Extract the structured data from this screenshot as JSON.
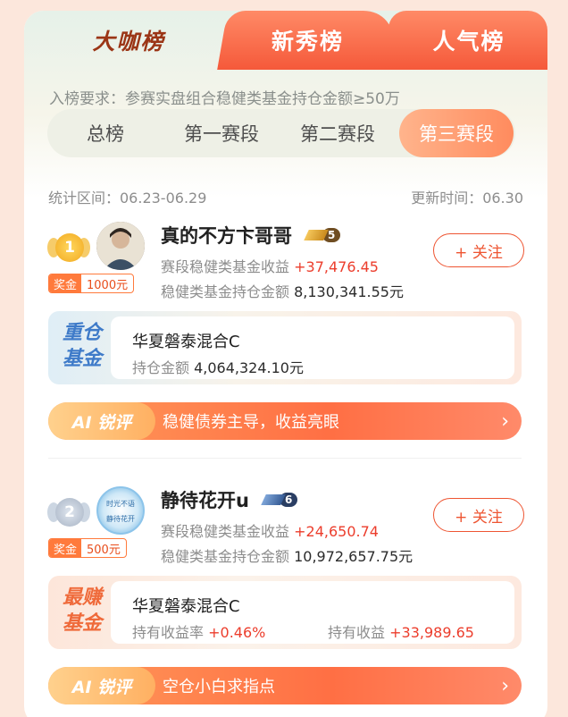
{
  "tabs": {
    "main": "大咖榜",
    "second": "新秀榜",
    "third": "人气榜"
  },
  "requirement": "入榜要求：参赛实盘组合稳健类基金持仓金额≥50万",
  "segments": [
    "总榜",
    "第一赛段",
    "第二赛段",
    "第三赛段"
  ],
  "active_segment": "第三赛段",
  "stats": {
    "period": "统计区间：06.23-06.29",
    "updated": "更新时间：06.30"
  },
  "entries": [
    {
      "rank": "1",
      "prize_label": "奖金",
      "prize_amount": "1000元",
      "name": "真的不方卞哥哥",
      "level": "5",
      "follow": "+ 关注",
      "income_label": "赛段稳健类基金收益",
      "income_value": "+37,476.45",
      "holding_label": "稳健类基金持仓金额",
      "holding_value": "8,130,341.55元",
      "fund_tag_1": "重仓",
      "fund_tag_2": "基金",
      "fund_name": "华夏磐泰混合C",
      "fund_sub_label": "持仓金额",
      "fund_sub_value": "4,064,324.10元",
      "ai_label": "AI 锐评",
      "ai_text": "稳健债券主导，收益亮眼"
    },
    {
      "rank": "2",
      "prize_label": "奖金",
      "prize_amount": "500元",
      "name": "静待花开u",
      "level": "6",
      "avatar_text_top": "时光不语",
      "avatar_text_bottom": "静待花开",
      "follow": "+ 关注",
      "income_label": "赛段稳健类基金收益",
      "income_value": "+24,650.74",
      "holding_label": "稳健类基金持仓金额",
      "holding_value": "10,972,657.75元",
      "fund_tag_1": "最赚",
      "fund_tag_2": "基金",
      "fund_name": "华夏磐泰混合C",
      "fund_rate_label": "持有收益率",
      "fund_rate_value": "+0.46%",
      "fund_income_label": "持有收益",
      "fund_income_value": "+33,989.65",
      "ai_label": "AI 锐评",
      "ai_text": "空仓小白求指点"
    }
  ],
  "colors": {
    "accent": "#ff6f44",
    "red": "#ec3d2c",
    "gold": "#f2a91f",
    "silver": "#a7b3c4"
  },
  "icons": {
    "chevron": "chevron-right-icon",
    "medal": "medal-icon",
    "level": "level-badge-icon"
  }
}
